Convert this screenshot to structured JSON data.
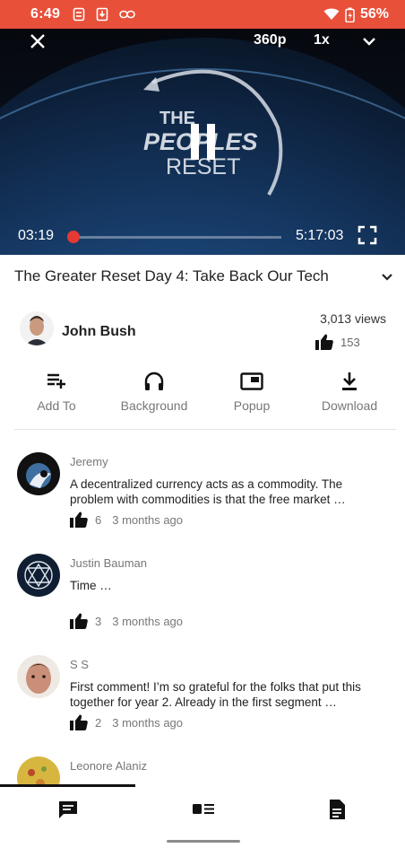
{
  "status_bar": {
    "time": "6:49",
    "battery": "56%"
  },
  "player": {
    "quality": "360p",
    "speed": "1x",
    "current_time": "03:19",
    "duration": "5:17:03",
    "progress": 0.01
  },
  "video": {
    "title": "The Greater Reset Day 4: Take Back Our Tech",
    "uploader": "John Bush",
    "views": "3,013 views",
    "likes": "153"
  },
  "actions": [
    {
      "label": "Add To",
      "icon": "playlist-add-icon"
    },
    {
      "label": "Background",
      "icon": "headphones-icon"
    },
    {
      "label": "Popup",
      "icon": "popup-icon"
    },
    {
      "label": "Download",
      "icon": "download-icon"
    }
  ],
  "comments": [
    {
      "author": "Jeremy",
      "text": "A decentralized currency acts as a commodity. The problem with commodities is that the free market …",
      "likes": "6",
      "date": "3 months ago"
    },
    {
      "author": "Justin Bauman",
      "text": "Time …",
      "likes": "3",
      "date": "3 months ago"
    },
    {
      "author": "S S",
      "text": "First comment! I’m so grateful for the folks that put this together for year 2. Already in the first segment …",
      "likes": "2",
      "date": "3 months ago"
    },
    {
      "author": "Leonore Alaniz",
      "text": "",
      "likes": "",
      "date": ""
    }
  ],
  "tabs": [
    {
      "icon": "comments-icon"
    },
    {
      "icon": "related-videos-icon"
    },
    {
      "icon": "description-icon"
    }
  ],
  "colors": {
    "status_bar": "#e8503a",
    "accent": "#e53935"
  }
}
